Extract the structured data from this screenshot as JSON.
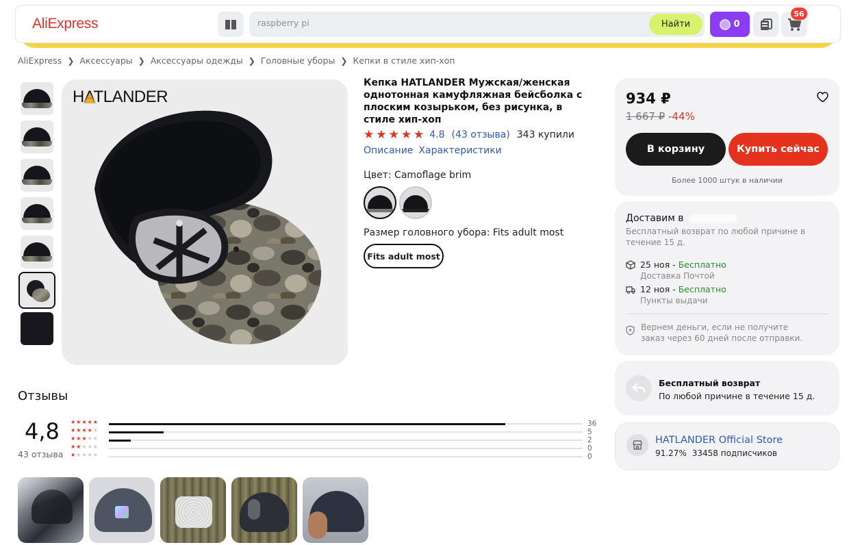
{
  "header": {
    "logo": "AliExpress",
    "search_value": "raspberry pi",
    "search_button": "Найти",
    "coins": "0",
    "cart_count": "56"
  },
  "breadcrumb": [
    "AliExpress",
    "Аксессуары",
    "Аксессуары одежды",
    "Головные уборы",
    "Кепки в стиле хип-хоп"
  ],
  "gallery": {
    "brand_logo": "HATLANDER"
  },
  "product": {
    "title": "Кепка HATLANDER Мужская/женская однотонная камуфляжная бейсболка с плоским козырьком, без рисунка, в стиле хип-хоп",
    "rating": "4.8",
    "reviews_link": "(43 отзыва)",
    "bought": "343 купили",
    "tab_description": "Описание",
    "tab_specs": "Характеристики",
    "color_label": "Цвет: Camoflage brim",
    "size_label": "Размер головного убора: Fits adult most",
    "size_option": "Fits adult most"
  },
  "buy_box": {
    "price": "934 ₽",
    "old_price": "1 667 ₽",
    "discount": "-44%",
    "cart_button": "В корзину",
    "buy_button": "Купить сейчас",
    "stock": "Более 1000 штук в наличии"
  },
  "delivery": {
    "deliver_to": "Доставим в",
    "return_note": "Бесплатный возврат по любой причине в течение 15 д.",
    "options": [
      {
        "date": "25 ноя",
        "sep": " - ",
        "price": "Бесплатно",
        "method": "Доставка Почтой"
      },
      {
        "date": "12 ноя",
        "sep": " - ",
        "price": "Бесплатно",
        "method": "Пункты выдачи"
      }
    ],
    "guarantee": "Вернем деньги, если не получите заказ через 60 дней после отправки."
  },
  "free_return": {
    "title": "Бесплатный возврат",
    "subtitle": "По любой причине в течение 15 д."
  },
  "store": {
    "name": "HATLANDER Official Store",
    "rating": "91.27%",
    "followers": "33458 подписчиков"
  },
  "reviews": {
    "title": "Отзывы",
    "average": "4,8",
    "count": "43 отзыва",
    "distribution": [
      {
        "stars": 5,
        "count": 36
      },
      {
        "stars": 4,
        "count": 5
      },
      {
        "stars": 3,
        "count": 2
      },
      {
        "stars": 2,
        "count": 0
      },
      {
        "stars": 1,
        "count": 0
      }
    ]
  },
  "colors": {
    "accent_red": "#e4321f",
    "link_blue": "#2f5bb5",
    "search_button": "#d8f36b",
    "coins_purple": "#8b3cf5",
    "banner_yellow": "#f6d247"
  }
}
